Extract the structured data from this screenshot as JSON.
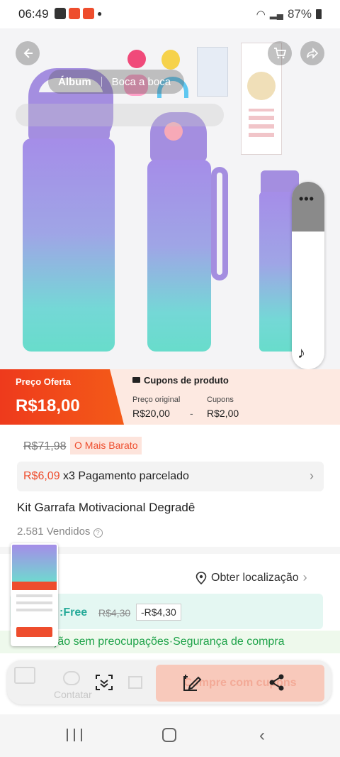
{
  "status_bar": {
    "time": "06:49",
    "battery": "87%"
  },
  "hero": {
    "tabs": [
      "Álbum",
      "Boca a boca"
    ],
    "active_tab": "Álbum"
  },
  "price": {
    "offer_label": "Preço Oferta",
    "offer_price": "R$18,00",
    "coupons_header": "Cupons de produto",
    "original_label": "Preço original",
    "original_value": "R$20,00",
    "minus": "-",
    "coupons_label": "Cupons",
    "coupons_value": "R$2,00"
  },
  "info": {
    "old_price": "R$71,98",
    "cheapest_badge": "O Mais Barato",
    "installment_amount": "R$6,09",
    "installment_text": " x3 Pagamento parcelado",
    "title": "Kit Garrafa Motivacional Degradê",
    "sold": "2.581 Vendidos"
  },
  "shipping": {
    "location_label": "Obter localização",
    "free_label": ":Free",
    "old_shipping": "R$4,30",
    "discount": "-R$4,30",
    "guarantee": "olução sem preocupações·Segurança de compra"
  },
  "bottom_bar": {
    "contact": "Contatar",
    "cta": "Compre com cupons"
  }
}
